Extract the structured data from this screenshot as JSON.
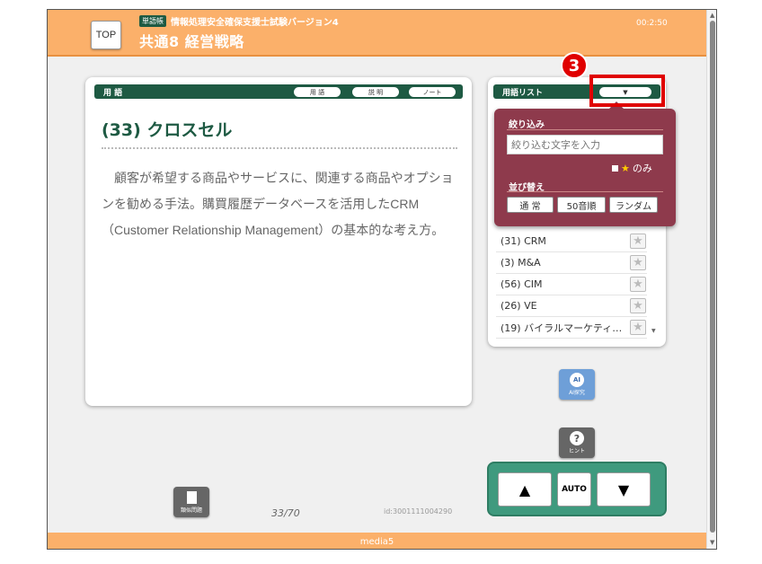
{
  "header": {
    "top_label": "TOP",
    "badge": "単語帳",
    "subtitle": "情報処理安全確保支援士試験バージョン4",
    "title": "共通8 経営戦略",
    "timer": "00:2:50"
  },
  "card": {
    "bar_label": "用 語",
    "buttons": [
      "用 語",
      "説 明",
      "ノート"
    ],
    "term_title": "(33) クロスセル",
    "description": "顧客が希望する商品やサービスに、関連する商品やオプションを勧める手法。購買履歴データベースを活用したCRM（Customer Relationship Management）の基本的な考え方。"
  },
  "list": {
    "bar_label": "用語リスト",
    "filter_button": "▼",
    "items": [
      {
        "label": "(31) CRM"
      },
      {
        "label": "(3) M&A"
      },
      {
        "label": "(56) CIM"
      },
      {
        "label": "(26) VE"
      },
      {
        "label": "(19) バイラルマーケティ…"
      }
    ],
    "star_glyph": "★"
  },
  "callout": {
    "number": "3"
  },
  "popup": {
    "filter_heading": "絞り込み",
    "filter_placeholder": "絞り込む文字を入力",
    "star_only_star": "★",
    "star_only_label": "のみ",
    "sort_heading": "並び替え",
    "sort_buttons": [
      "通 常",
      "50音順",
      "ランダム"
    ]
  },
  "tools": {
    "ai_glyph": "AI",
    "ai_label": "AI探究",
    "hint_glyph": "?",
    "hint_label": "ヒント",
    "similar_label": "類似問題"
  },
  "nav": {
    "up": "▲",
    "auto": "AUTO",
    "down": "▼"
  },
  "status": {
    "page_counter": "33/70",
    "item_id": "id:3001111004290"
  },
  "footer": {
    "label": "media5"
  },
  "colors": {
    "header": "#fbb06a",
    "term_green": "#1e5a43",
    "popup": "#8e3a4c",
    "nav_pad": "#3f9a7e",
    "callout_red": "#e00000"
  }
}
